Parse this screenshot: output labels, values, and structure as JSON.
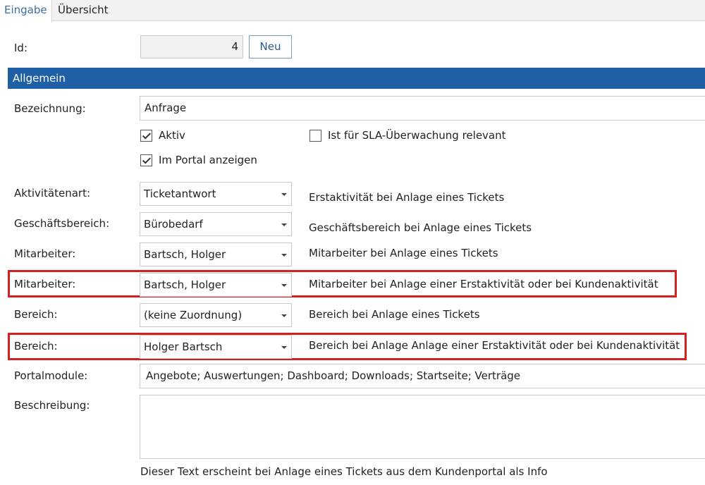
{
  "tabs": [
    {
      "label": "Eingabe",
      "active": true
    },
    {
      "label": "Übersicht",
      "active": false
    }
  ],
  "id_row": {
    "label": "Id:",
    "value": "4",
    "new_button": "Neu"
  },
  "section_title": "Allgemein",
  "bezeichnung": {
    "label": "Bezeichnung:",
    "value": "Anfrage"
  },
  "checkboxes": {
    "aktiv": {
      "label": "Aktiv",
      "checked": true
    },
    "sla": {
      "label": "Ist für SLA-Überwachung relevant",
      "checked": false
    },
    "portal": {
      "label": "Im Portal anzeigen",
      "checked": true
    }
  },
  "rows": [
    {
      "label": "Aktivitätenart:",
      "value": "Ticketantwort",
      "note": "Erstaktivität bei Anlage eines Tickets",
      "highlighted": false
    },
    {
      "label": "Geschäftsbereich:",
      "value": "Bürobedarf",
      "note": "Geschäftsbereich bei Anlage eines Tickets",
      "highlighted": false
    },
    {
      "label": "Mitarbeiter:",
      "value": "Bartsch, Holger",
      "note": "Mitarbeiter bei Anlage eines Tickets",
      "highlighted": false
    },
    {
      "label": "Mitarbeiter:",
      "value": "Bartsch, Holger",
      "note": "Mitarbeiter bei Anlage einer Erstaktivität oder bei Kundenaktivität",
      "highlighted": true
    },
    {
      "label": "Bereich:",
      "value": "(keine Zuordnung)",
      "note": "Bereich bei Anlage eines Tickets",
      "highlighted": false
    },
    {
      "label": "Bereich:",
      "value": "Holger Bartsch",
      "note": "Bereich bei Anlage Anlage einer Erstaktivität oder bei Kundenaktivität",
      "highlighted": true
    }
  ],
  "portalmodule": {
    "label": "Portalmodule:",
    "value": "Angebote; Auswertungen; Dashboard; Downloads; Startseite; Verträge"
  },
  "beschreibung": {
    "label": "Beschreibung:",
    "value": "",
    "hint": "Dieser Text erscheint bei Anlage eines Tickets aus dem Kundenportal als Info"
  },
  "colors": {
    "accent": "#1f5fa6",
    "highlight": "#d42020",
    "tab_active": "#3a6ea5"
  }
}
